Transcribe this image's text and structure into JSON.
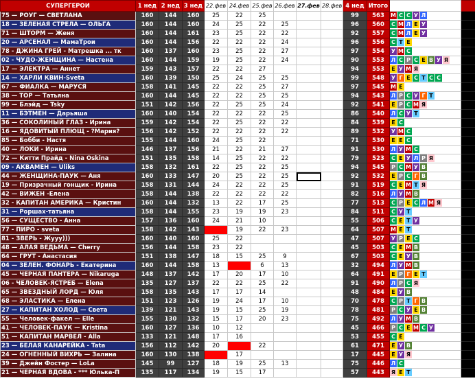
{
  "headers": {
    "title": "СУПЕРГЕРОИ",
    "w1": "1 нед",
    "w2": "2 нед",
    "w3": "3 нед",
    "d1": "22.фев",
    "d2": "24.фев",
    "d3": "25.фев",
    "d4": "26.фев",
    "d5": "27.фев",
    "d6": "28.фев",
    "w4": "4 нед",
    "total": "Итого"
  },
  "colors": {
    "maroon": "#5a1010",
    "navy": "#1f2b78",
    "gray": "#3f3f3f",
    "red": "#c00000"
  },
  "badge_colors": {
    "М": "#c00000",
    "С": "#00a651",
    "Е": "#ffd700",
    "У": "#7030a0",
    "Л": "#3366ff",
    "Г": "#ff6600",
    "Т": "#66ccff",
    "В": "#548235",
    "Я": "#ffc7ce",
    "Р": "#808080"
  },
  "rows": [
    {
      "name": "75 — РОУГ — СВЕТЛАНА",
      "bg": "maroon",
      "w": [
        160,
        144,
        160
      ],
      "d": [
        "25",
        "22",
        "25",
        "",
        "",
        ""
      ],
      "r": [],
      "w4": "99",
      "tot": "563",
      "badges": "МССУЛ"
    },
    {
      "name": "18 — ЗЕЛЕНАЯ СТРЕЛА — ОЛЬГА",
      "bg": "navy",
      "w": [
        160,
        144,
        160
      ],
      "d": [
        "24",
        "25",
        "22",
        "25",
        "",
        ""
      ],
      "r": [],
      "w4": "96",
      "tot": "560",
      "badges": "СМЛЕУ"
    },
    {
      "name": "71 — ШТОРМ — Женя",
      "bg": "maroon",
      "w": [
        160,
        144,
        161
      ],
      "d": [
        "23",
        "25",
        "22",
        "22",
        "",
        ""
      ],
      "r": [],
      "w4": "92",
      "tot": "557",
      "badges": "СМЛЕУ"
    },
    {
      "name": "20 — АРСЕНАЛ — МамаТрои",
      "bg": "navy",
      "w": [
        160,
        144,
        156
      ],
      "d": [
        "22",
        "22",
        "22",
        "24",
        "",
        ""
      ],
      "r": [],
      "w4": "96",
      "tot": "556",
      "badges": "СТЕ"
    },
    {
      "name": "78 - ДЖИНА ГРЕЙ - Матрешка ... тк",
      "bg": "maroon",
      "w": [
        160,
        137,
        160
      ],
      "d": [
        "23",
        "25",
        "22",
        "27",
        "",
        ""
      ],
      "r": [],
      "w4": "97",
      "tot": "554",
      "badges": "УМС"
    },
    {
      "name": "02 - ЧУДО-ЖЕНЩИНА — Настена",
      "bg": "navy",
      "w": [
        160,
        144,
        159
      ],
      "d": [
        "19",
        "25",
        "22",
        "24",
        "",
        ""
      ],
      "r": [],
      "w4": "90",
      "tot": "553",
      "badges": "ЛСРСЕВУЯ"
    },
    {
      "name": "17 — ЭЛЕКТРА — Аннет",
      "bg": "maroon",
      "w": [
        159,
        143,
        157
      ],
      "d": [
        "22",
        "22",
        "27",
        "",
        "",
        ""
      ],
      "r": [],
      "w4": "94",
      "tot": "553",
      "badges": "ЕУМЯ"
    },
    {
      "name": "14 — ХАРЛИ КВИН-Sveta",
      "bg": "navy",
      "w": [
        160,
        139,
        150
      ],
      "d": [
        "25",
        "24",
        "25",
        "25",
        "",
        ""
      ],
      "r": [],
      "w4": "99",
      "tot": "548",
      "badges": "УГЕСТСС"
    },
    {
      "name": "67 — ФИАЛКА — МАРУСЯ",
      "bg": "maroon",
      "w": [
        158,
        141,
        145
      ],
      "d": [
        "22",
        "22",
        "25",
        "27",
        "",
        ""
      ],
      "r": [],
      "w4": "97",
      "tot": "545",
      "badges": "МЕ"
    },
    {
      "name": "38 — ТОР — Татьяна",
      "bg": "maroon",
      "w": [
        160,
        144,
        145
      ],
      "d": [
        "22",
        "22",
        "25",
        "25",
        "",
        ""
      ],
      "r": [],
      "w4": "94",
      "tot": "543",
      "badges": "ЛРСУГТ"
    },
    {
      "name": "99 — Блэйд — Tsky",
      "bg": "maroon",
      "w": [
        151,
        142,
        156
      ],
      "d": [
        "22",
        "25",
        "25",
        "24",
        "",
        ""
      ],
      "r": [],
      "w4": "92",
      "tot": "541",
      "badges": "ЕРСМЯ"
    },
    {
      "name": "11 — БЭТМЕН — Дарьяша",
      "bg": "navy",
      "w": [
        160,
        140,
        154
      ],
      "d": [
        "22",
        "22",
        "22",
        "25",
        "",
        ""
      ],
      "r": [],
      "w4": "86",
      "tot": "540",
      "badges": "ЛСУТ"
    },
    {
      "name": "36 — СОКОЛИНЫЙ ГЛАЗ - Ирина",
      "bg": "maroon",
      "w": [
        159,
        142,
        154
      ],
      "d": [
        "22",
        "25",
        "22",
        "22",
        "",
        ""
      ],
      "r": [],
      "w4": "84",
      "tot": "539",
      "badges": "ЕС"
    },
    {
      "name": "16 — ЯДОВИТЫЙ ПЛЮЩ - ?Мария?",
      "bg": "maroon",
      "w": [
        156,
        142,
        152
      ],
      "d": [
        "22",
        "22",
        "22",
        "22",
        "",
        ""
      ],
      "r": [],
      "w4": "89",
      "tot": "532",
      "badges": "УМС"
    },
    {
      "name": "85 — Бобби - Настя",
      "bg": "maroon",
      "w": [
        155,
        144,
        160
      ],
      "d": [
        "24",
        "25",
        "22",
        "",
        "",
        ""
      ],
      "r": [],
      "w4": "71",
      "tot": "530",
      "badges": "ЕЕС"
    },
    {
      "name": "40 — ЛОКИ - Ирина",
      "bg": "maroon",
      "w": [
        146,
        137,
        156
      ],
      "d": [
        "21",
        "22",
        "21",
        "27",
        "",
        ""
      ],
      "r": [],
      "w4": "91",
      "tot": "530",
      "badges": "ЛУМС"
    },
    {
      "name": "72 — Китти Прайд - Nina Oskina",
      "bg": "maroon",
      "w": [
        151,
        135,
        158
      ],
      "d": [
        "14",
        "25",
        "22",
        "22",
        "",
        ""
      ],
      "r": [],
      "w4": "79",
      "tot": "523",
      "badges": "СЕУЛРЯ"
    },
    {
      "name": "09 - АКВАМЕН — Uliks",
      "bg": "navy",
      "w": [
        158,
        132,
        161
      ],
      "d": [
        "22",
        "25",
        "22",
        "25",
        "",
        ""
      ],
      "r": [],
      "w4": "94",
      "tot": "545",
      "badges": "РСМУВ"
    },
    {
      "name": "44 — ЖЕНЩИНА-ПАУК — Аня",
      "bg": "maroon",
      "w": [
        160,
        133,
        147
      ],
      "d": [
        "20",
        "25",
        "22",
        "25",
        "",
        ""
      ],
      "r": [],
      "w4": "92",
      "tot": "532",
      "badges": "ЕРСГВ"
    },
    {
      "name": "19 — Призрачный гонщик - Ирина",
      "bg": "maroon",
      "w": [
        158,
        131,
        144
      ],
      "d": [
        "24",
        "22",
        "22",
        "25",
        "",
        ""
      ],
      "r": [],
      "w4": "91",
      "tot": "519",
      "badges": "СЕМТЯ"
    },
    {
      "name": "42 — ВИЖЕН -Елена",
      "bg": "maroon",
      "w": [
        158,
        144,
        138
      ],
      "d": [
        "22",
        "22",
        "22",
        "22",
        "",
        ""
      ],
      "r": [],
      "w4": "82",
      "tot": "516",
      "badges": "ЛУМВ"
    },
    {
      "name": "32 - КАПИТАН АМЕРИКА — Кристин",
      "bg": "maroon",
      "w": [
        160,
        144,
        132
      ],
      "d": [
        "13",
        "22",
        "17",
        "25",
        "",
        ""
      ],
      "r": [],
      "w4": "77",
      "tot": "513",
      "badges": "СРЕСЛМЯ"
    },
    {
      "name": "31 — Роршах-татьяна",
      "bg": "navy",
      "w": [
        158,
        144,
        155
      ],
      "d": [
        "23",
        "19",
        "19",
        "23",
        "",
        ""
      ],
      "r": [],
      "w4": "84",
      "tot": "511",
      "badges": "СУТ"
    },
    {
      "name": "56 — СУЩЕСТВО - Анна",
      "bg": "maroon",
      "w": [
        157,
        136,
        160
      ],
      "d": [
        "24",
        "21",
        "10",
        "",
        "",
        ""
      ],
      "r": [],
      "w4": "55",
      "tot": "506",
      "badges": "СЕТУ"
    },
    {
      "name": "77 - ПИРО - sveta",
      "bg": "maroon",
      "w": [
        158,
        142,
        143
      ],
      "d": [
        "",
        "19",
        "22",
        "23",
        "",
        ""
      ],
      "r": [
        0
      ],
      "w4": "64",
      "tot": "507",
      "badges": "МЕТ"
    },
    {
      "name": "81 - ЗВЕРЬ - Жууу)))",
      "bg": "maroon",
      "w": [
        160,
        140,
        160
      ],
      "d": [
        "25",
        "22",
        "",
        "",
        "",
        ""
      ],
      "r": [],
      "w4": "47",
      "tot": "507",
      "badges": "УРЕС"
    },
    {
      "name": "48 — АЛАЯ ВЕДЬМА — Cherry",
      "bg": "maroon",
      "w": [
        156,
        144,
        158
      ],
      "d": [
        "23",
        "22",
        "",
        "",
        "",
        ""
      ],
      "r": [],
      "w4": "45",
      "tot": "503",
      "badges": "СЕМВ"
    },
    {
      "name": "64 — ГРУТ - Анастасия",
      "bg": "maroon",
      "w": [
        151,
        138,
        147
      ],
      "d": [
        "18",
        "15",
        "25",
        "9",
        "",
        ""
      ],
      "r": [],
      "w4": "67",
      "tot": "503",
      "badges": "СЕУВ"
    },
    {
      "name": "04 — ЗЕЛЕН. ФОНАРЬ - Екатерина",
      "bg": "navy",
      "w": [
        160,
        144,
        158
      ],
      "d": [
        "13",
        "",
        "6",
        "13",
        "",
        ""
      ],
      "r": [
        1
      ],
      "w4": "32",
      "tot": "494",
      "badges": "ЛУМВ"
    },
    {
      "name": "45 — ЧЕРНАЯ ПАНТЕРА — Nikaruga",
      "bg": "maroon",
      "w": [
        148,
        137,
        142
      ],
      "d": [
        "17",
        "20",
        "17",
        "10",
        "",
        ""
      ],
      "r": [],
      "w4": "64",
      "tot": "491",
      "badges": "ЕРГЕТ"
    },
    {
      "name": "06 - ЧЕЛОВЕК-ЯСТРЕБ — Elena",
      "bg": "maroon",
      "w": [
        135,
        127,
        137
      ],
      "d": [
        "22",
        "22",
        "25",
        "22",
        "",
        ""
      ],
      "r": [],
      "w4": "91",
      "tot": "490",
      "badges": "ЛРСЯ"
    },
    {
      "name": "65 — ЗВЕЗДНЫЙ ЛОРД — Юля",
      "bg": "maroon",
      "w": [
        158,
        135,
        143
      ],
      "d": [
        "17",
        "17",
        "14",
        "",
        "",
        ""
      ],
      "r": [],
      "w4": "48",
      "tot": "484",
      "badges": "ЕУВ"
    },
    {
      "name": "68 — ЭЛАСТИКА — Елена",
      "bg": "maroon",
      "w": [
        151,
        123,
        126
      ],
      "d": [
        "19",
        "24",
        "17",
        "10",
        "",
        ""
      ],
      "r": [],
      "w4": "70",
      "tot": "478",
      "badges": "СРТГВ"
    },
    {
      "name": "27 — КАПИТАН ХОЛОД — Света",
      "bg": "navy",
      "w": [
        139,
        121,
        143
      ],
      "d": [
        "19",
        "15",
        "25",
        "19",
        "",
        ""
      ],
      "r": [],
      "w4": "78",
      "tot": "481",
      "badges": "РСУЕВ"
    },
    {
      "name": "55 — Человек-факел — Elle",
      "bg": "maroon",
      "w": [
        155,
        130,
        132
      ],
      "d": [
        "15",
        "17",
        "20",
        "23",
        "",
        ""
      ],
      "r": [],
      "w4": "75",
      "tot": "492",
      "badges": "ЛУМВ"
    },
    {
      "name": "41 — ЧЕЛОВЕК-ПАУК — Kristina",
      "bg": "maroon",
      "w": [
        160,
        127,
        136
      ],
      "d": [
        "10",
        "12",
        "",
        "",
        "",
        ""
      ],
      "r": [],
      "w4": "45",
      "tot": "466",
      "badges": "РСЕМСУ"
    },
    {
      "name": "51 — КАПИТАН МАРВЕЛ - Alla",
      "bg": "maroon",
      "w": [
        133,
        121,
        148
      ],
      "d": [
        "17",
        "16",
        "",
        "",
        "",
        ""
      ],
      "r": [],
      "w4": "53",
      "tot": "455",
      "badges": "СЕ"
    },
    {
      "name": "23 — БЕЛАЯ КАНАРЕЙКА - Tata",
      "bg": "navy",
      "w": [
        156,
        112,
        142
      ],
      "d": [
        "20",
        "",
        "22",
        "",
        "",
        ""
      ],
      "r": [
        1
      ],
      "w4": "61",
      "tot": "471",
      "badges": "ЕУВ"
    },
    {
      "name": "24 — ОГНЕННЫЙ ВИХРЬ — Залина",
      "bg": "maroon",
      "w": [
        160,
        130,
        138
      ],
      "d": [
        "",
        "17",
        "",
        "",
        "",
        ""
      ],
      "r": [
        0
      ],
      "w4": "17",
      "tot": "445",
      "badges": "ЕУЯ"
    },
    {
      "name": "39 — Джейн Фостер — LoLa",
      "bg": "maroon",
      "w": [
        145,
        99,
        127
      ],
      "d": [
        "18",
        "19",
        "25",
        "13",
        "",
        ""
      ],
      "r": [],
      "w4": "75",
      "tot": "446",
      "badges": "ЛС"
    },
    {
      "name": "21 — ЧЕРНАЯ ВДОВА - *** Юлька-П",
      "bg": "maroon",
      "w": [
        135,
        117,
        134
      ],
      "d": [
        "19",
        "15",
        "17",
        "",
        "",
        ""
      ],
      "r": [],
      "w4": "57",
      "tot": "443",
      "badges": "ЯЕТ"
    }
  ]
}
